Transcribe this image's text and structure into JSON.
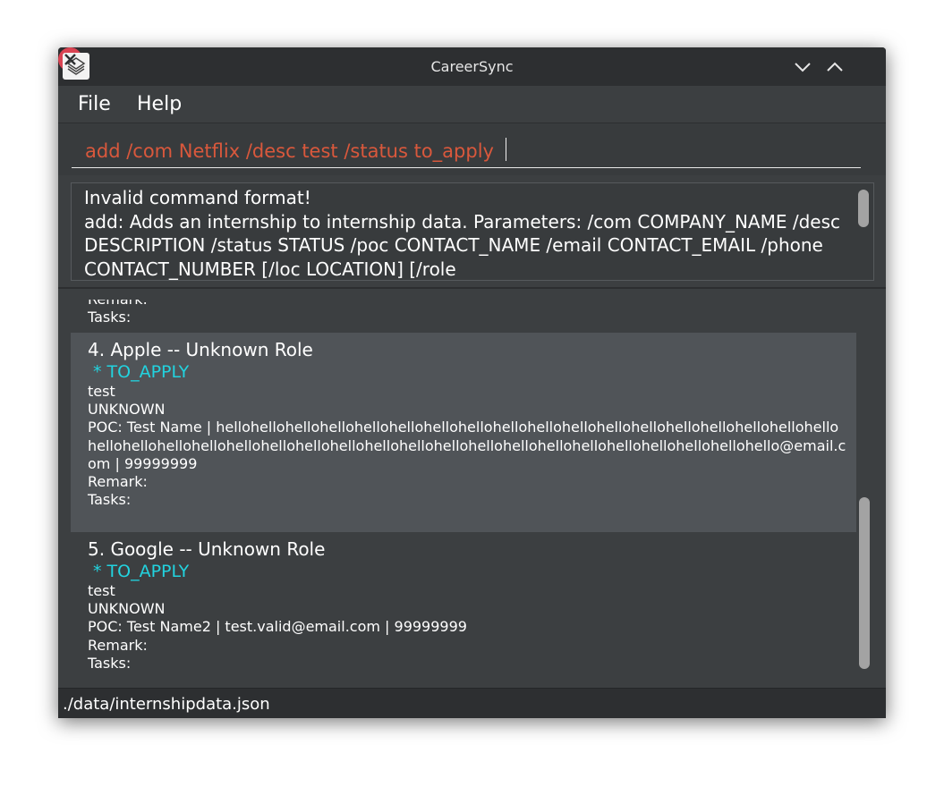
{
  "window": {
    "title": "CareerSync",
    "icons": {
      "app": "app-logo-icon",
      "minimize": "chevron-down-icon",
      "maximize": "chevron-up-icon",
      "close": "close-icon"
    }
  },
  "menu": {
    "file": "File",
    "help": "Help"
  },
  "command": {
    "value": "add /com Netflix /desc test /status to_apply"
  },
  "result": {
    "text": "Invalid command format!\nadd: Adds an internship to internship data. Parameters: /com COMPANY_NAME /desc DESCRIPTION /status STATUS /poc CONTACT_NAME /email CONTACT_EMAIL /phone CONTACT_NUMBER [/loc LOCATION] [/role"
  },
  "list": {
    "partial": {
      "remark": "Remark:",
      "tasks": "Tasks:"
    },
    "items": [
      {
        "header": "4.  Apple -- Unknown Role",
        "status": " * TO_APPLY",
        "description": "test",
        "location": "UNKNOWN",
        "poc": "POC: Test Name | hellohellohellohellohellohellohellohellohellohellohellohellohellohellohellohellohellohellohellohellohellohellohellohellohellohellohellohellohellohellohellohellohellohellohellohellohellohello@email.com | 99999999",
        "remark": "Remark:",
        "tasks": "Tasks:"
      },
      {
        "header": "5.  Google -- Unknown Role",
        "status": " * TO_APPLY",
        "description": "test",
        "location": "UNKNOWN",
        "poc": "POC: Test Name2 | test.valid@email.com | 99999999",
        "remark": "Remark:",
        "tasks": "Tasks:"
      }
    ]
  },
  "statusbar": {
    "path": "./data/internshipdata.json"
  },
  "colors": {
    "command_text": "#d9583c",
    "status_text": "#22d3df",
    "close_button": "#da4453"
  }
}
